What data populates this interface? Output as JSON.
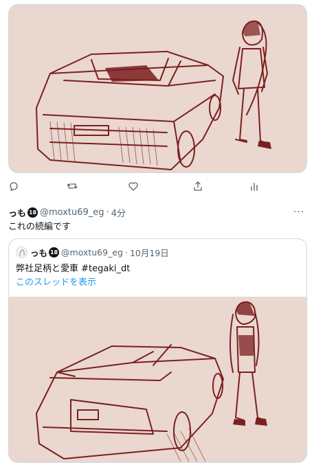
{
  "colors": {
    "media_bg": "#ead7cf",
    "ink": "#7a1f1f",
    "link": "#1d9bf0",
    "muted": "#536471"
  },
  "actions": {
    "reply": "reply-icon",
    "retweet": "retweet-icon",
    "like": "heart-icon",
    "share": "share-icon",
    "analytics": "analytics-icon"
  },
  "tweet": {
    "name": "っも",
    "badge": "18",
    "handle": "@moxtu69_eg",
    "separator": "·",
    "time": "4分",
    "text": "これの続編です",
    "more": "···"
  },
  "quote": {
    "name": "っも",
    "badge": "18",
    "handle": "@moxtu69_eg",
    "separator": "·",
    "date": "10月19日",
    "text": "弊社足柄と愛車 #tegaki_dt",
    "thread_link": "このスレッドを表示"
  }
}
